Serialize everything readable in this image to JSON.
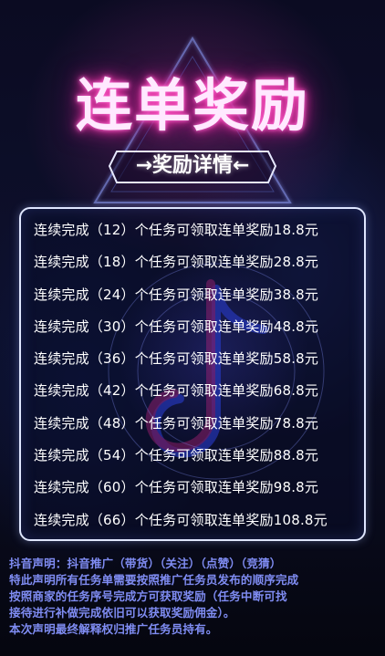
{
  "title": "连单奖励",
  "subtitle": "→奖励详情←",
  "rows": [
    {
      "prefix": "连续完成（",
      "count": "12",
      "suffix": "）个任务可领取连单奖励",
      "amount": "18.8元"
    },
    {
      "prefix": "连续完成（",
      "count": "18",
      "suffix": "）个任务可领取连单奖励",
      "amount": "28.8元"
    },
    {
      "prefix": "连续完成（",
      "count": "24",
      "suffix": "）个任务可领取连单奖励",
      "amount": "38.8元"
    },
    {
      "prefix": "连续完成（",
      "count": "30",
      "suffix": "）个任务可领取连单奖励",
      "amount": "48.8元"
    },
    {
      "prefix": "连续完成（",
      "count": "36",
      "suffix": "）个任务可领取连单奖励",
      "amount": "58.8元"
    },
    {
      "prefix": "连续完成（",
      "count": "42",
      "suffix": "）个任务可领取连单奖励",
      "amount": "68.8元"
    },
    {
      "prefix": "连续完成（",
      "count": "48",
      "suffix": "）个任务可领取连单奖励",
      "amount": "78.8元"
    },
    {
      "prefix": "连续完成（",
      "count": "54",
      "suffix": "）个任务可领取连单奖励",
      "amount": "88.8元"
    },
    {
      "prefix": "连续完成（",
      "count": "60",
      "suffix": "）个任务可领取连单奖励",
      "amount": "98.8元"
    },
    {
      "prefix": "连续完成（",
      "count": "66",
      "suffix": "）个任务可领取连单奖励",
      "amount": "108.8元"
    }
  ],
  "notice": {
    "line1": "抖音声明：抖音推广（带货）（关注）（点赞）（竞猜）",
    "line2": "特此声明所有任务单需要按照推广任务员发布的顺序完成",
    "line3": "按照商家的任务序号完成方可获取奖励（任务中断可找",
    "line4": "接待进行补做完成依旧可以获取奖励佣金）。",
    "line5": "本次声明最终解释权归推广任务员持有。"
  },
  "colors": {
    "title_glow": "#ff3fb0",
    "notice_text": "#7f8cf2",
    "panel_border": "#dfe6ff"
  },
  "icons": {
    "background_logo": "tiktok-note-icon"
  }
}
